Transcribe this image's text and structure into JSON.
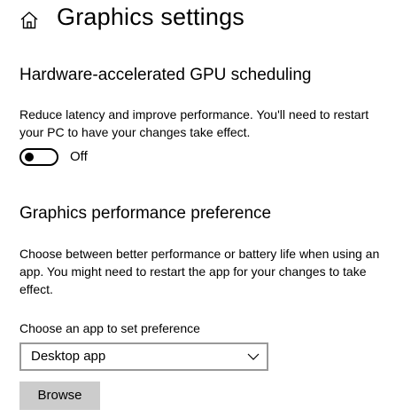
{
  "header": {
    "icon": "home-icon",
    "title": "Graphics settings"
  },
  "gpu_scheduling": {
    "title": "Hardware-accelerated GPU scheduling",
    "description_line1": "Reduce latency and improve performance. You'll need to restart",
    "description_line2": "your PC to have your changes take effect.",
    "toggle_on": false,
    "toggle_label": "Off"
  },
  "performance_preference": {
    "title": "Graphics performance preference",
    "description_line1": "Choose between better performance or battery life when using an",
    "description_line2": "app. You might need to restart the app for your changes to take",
    "description_line3": "effect.",
    "choose_label": "Choose an app to set preference",
    "dropdown_value": "Desktop app",
    "dropdown_icon": "chevron-down-icon",
    "browse_label": "Browse"
  },
  "colors": {
    "button_background": "#cccccc",
    "dropdown_border": "#999999",
    "text": "#000000"
  }
}
